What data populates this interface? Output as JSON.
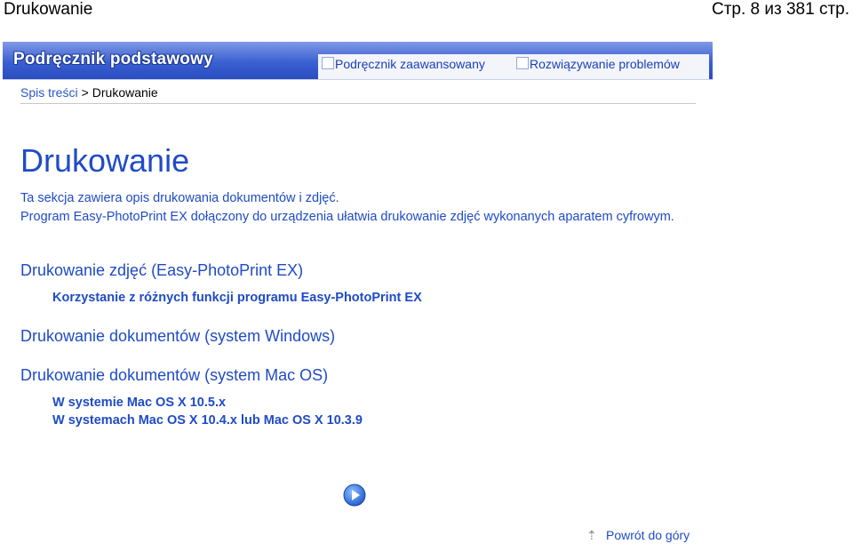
{
  "header": {
    "title": "Drukowanie",
    "page_counter": "Стр. 8 из 381 стр."
  },
  "banner": {
    "logo_text": "Podręcznik podstawowy",
    "tabs": [
      {
        "label": "Podręcznik zaawansowany"
      },
      {
        "label": "Rozwiązywanie problemów"
      }
    ]
  },
  "breadcrumb": {
    "home": "Spis treści",
    "separator": ">",
    "current": "Drukowanie"
  },
  "main": {
    "title": "Drukowanie",
    "intro_line1": "Ta sekcja zawiera opis drukowania dokumentów i zdjęć.",
    "intro_line2": "Program Easy-PhotoPrint EX dołączony do urządzenia ułatwia drukowanie zdjęć wykonanych aparatem cyfrowym.",
    "sections": [
      {
        "heading": "Drukowanie zdjęć (Easy-PhotoPrint EX)",
        "subs": [
          "Korzystanie z różnych funkcji programu Easy-PhotoPrint EX"
        ]
      },
      {
        "heading": "Drukowanie dokumentów (system Windows)",
        "subs": []
      },
      {
        "heading": "Drukowanie dokumentów (system Mac OS)",
        "subs": [
          "W systemie Mac OS X 10.5.x",
          "W systemach Mac OS X 10.4.x lub Mac OS X 10.3.9"
        ]
      }
    ]
  },
  "footer": {
    "next_icon": "next-page-icon",
    "back_to_top": "Powrót do góry"
  },
  "colors": {
    "link": "#1f4bc6",
    "banner": "#3a5fd1"
  }
}
